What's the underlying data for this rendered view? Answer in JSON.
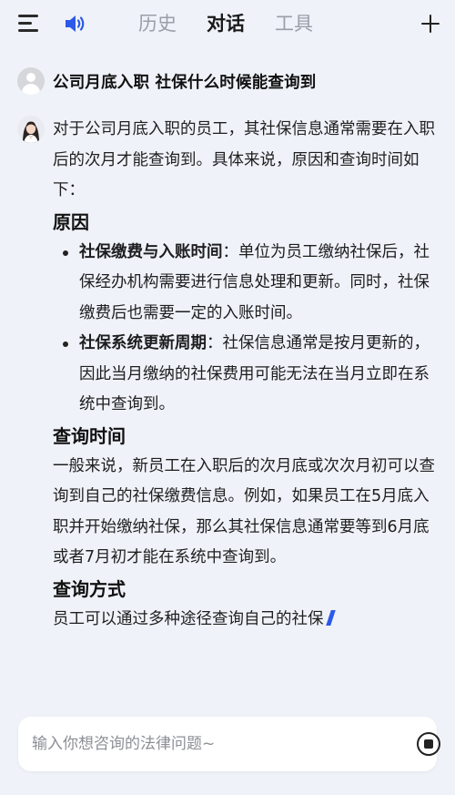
{
  "header": {
    "tabs": [
      {
        "label": "历史",
        "active": false
      },
      {
        "label": "对话",
        "active": true
      },
      {
        "label": "工具",
        "active": false
      }
    ],
    "icons": {
      "menu": "menu-icon",
      "speaker": "speaker-icon",
      "new": "plus-icon"
    }
  },
  "conversation": {
    "question": "公司月底入职 社保什么时候能查询到",
    "answer": {
      "intro": "对于公司月底入职的员工，其社保信息通常需要在入职后的次月才能查询到。具体来说，原因和查询时间如下：",
      "section1_heading": "原因",
      "bullets": [
        {
          "title": "社保缴费与入账时间",
          "text": "：单位为员工缴纳社保后，社保经办机构需要进行信息处理和更新。同时，社保缴费后也需要一定的入账时间。"
        },
        {
          "title": "社保系统更新周期",
          "text": "：社保信息通常是按月更新的，因此当月缴纳的社保费用可能无法在当月立即在系统中查询到。"
        }
      ],
      "section2_heading": "查询时间",
      "section2_text": "一般来说，新员工在入职后的次月底或次次月初可以查询到自己的社保缴费信息。例如，如果员工在5月底入职并开始缴纳社保，那么其社保信息通常要等到6月底或者7月初才能在系统中查询到。",
      "section3_heading": "查询方式",
      "section3_text": "员工可以通过多种途径查询自己的社保"
    }
  },
  "input": {
    "placeholder": "输入你想咨询的法律问题~",
    "value": ""
  },
  "colors": {
    "accent": "#2d59e8",
    "background": "#eff2f9"
  }
}
